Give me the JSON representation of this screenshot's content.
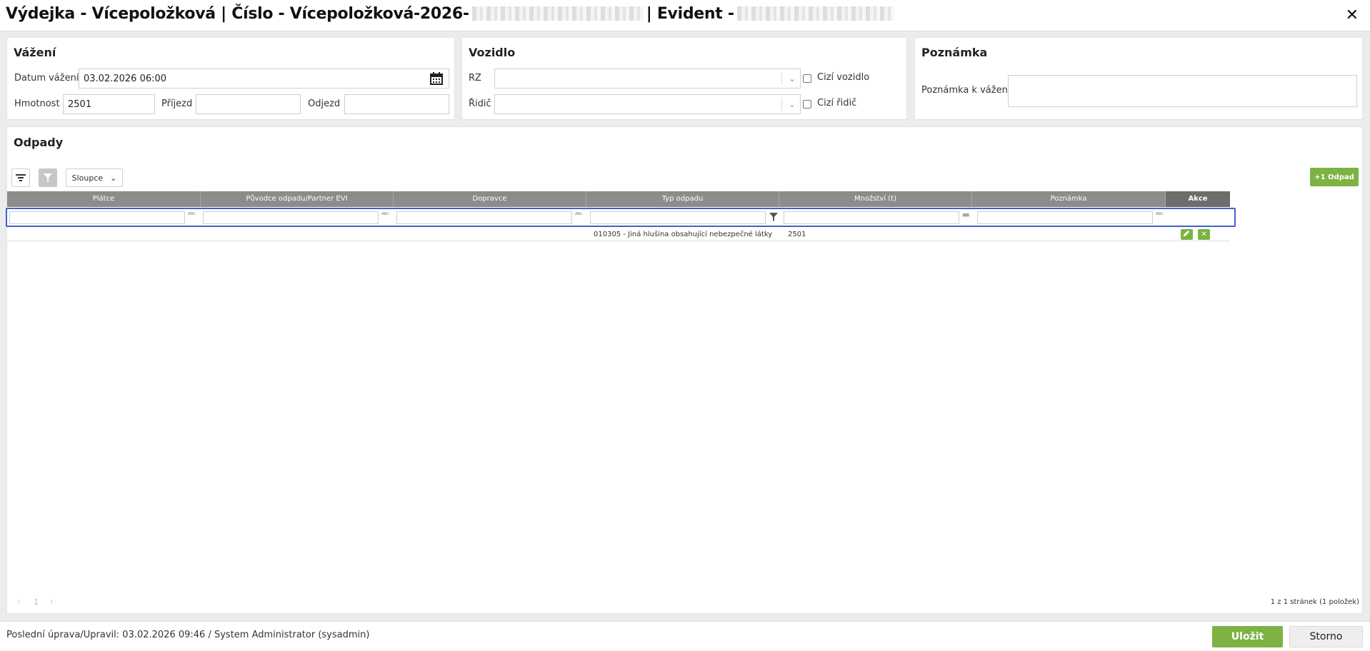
{
  "window": {
    "title_part1": "Výdejka - Vícepoložková | Číslo - Vícepoložková-2026-",
    "title_part2": "| Evident -"
  },
  "vazeni": {
    "title": "Vážení",
    "datum_label": "Datum vážení",
    "datum_value": "03.02.2026 06:00",
    "hmotnost_label": "Hmotnost",
    "hmotnost_value": "2501",
    "prijezd_label": "Příjezd",
    "prijezd_value": "",
    "odjezd_label": "Odjezd",
    "odjezd_value": ""
  },
  "vozidlo": {
    "title": "Vozidlo",
    "rz_label": "RZ",
    "ridic_label": "Řidič",
    "cizi_vozidlo_label": "Cizí vozidlo",
    "cizi_ridic_label": "Cizí řidič"
  },
  "poznamka": {
    "title": "Poznámka",
    "label": "Poznámka k vážení"
  },
  "odpady": {
    "title": "Odpady",
    "columns_button": "Sloupce",
    "add_button": "+1 Odpad",
    "headers": [
      "Plátce",
      "Původce odpadu/Partner EVI",
      "Dopravce",
      "Typ odpadu",
      "Množství (t)",
      "Poznámka",
      "Akce"
    ],
    "rows": [
      {
        "platce": "",
        "puvodce": "",
        "dopravce": "",
        "typ": "010305 - Jiná hlušina obsahující nebezpečné látky",
        "mnozstvi": "2501",
        "poznamka": ""
      }
    ],
    "pager_page": "1",
    "pager_info": "1 z 1 stránek (1 položek)"
  },
  "footer": {
    "last_edit": "Poslední úprava/Upravil: 03.02.2026 09:46 / System Administrator (sysadmin)",
    "save_button": "Uložit",
    "cancel_button": "Storno"
  },
  "colors": {
    "accent_green": "#7cb342",
    "highlight_blue": "#3e63c9",
    "header_gray": "#8c8c8c"
  }
}
